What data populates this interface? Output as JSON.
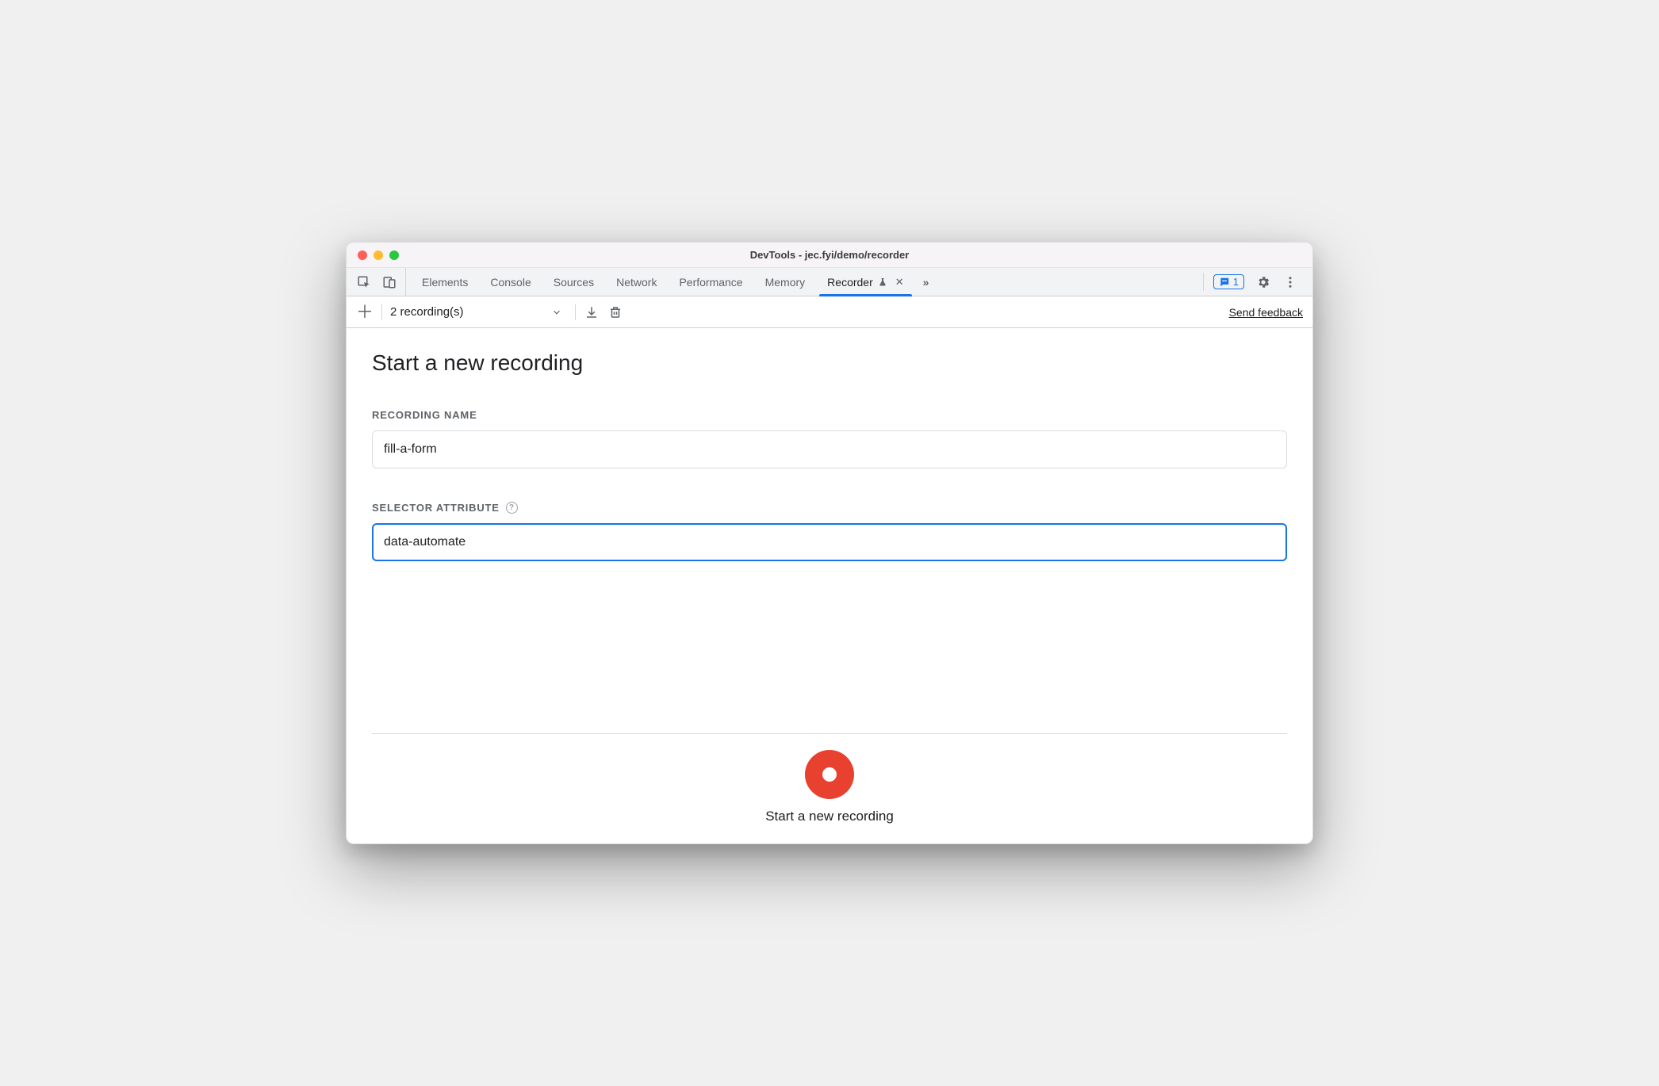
{
  "window": {
    "title": "DevTools - jec.fyi/demo/recorder"
  },
  "tabs": {
    "items": [
      {
        "label": "Elements"
      },
      {
        "label": "Console"
      },
      {
        "label": "Sources"
      },
      {
        "label": "Network"
      },
      {
        "label": "Performance"
      },
      {
        "label": "Memory"
      },
      {
        "label": "Recorder",
        "active": true,
        "flask": true,
        "closeable": true
      }
    ]
  },
  "badge": {
    "count": "1"
  },
  "subbar": {
    "recordings_label": "2 recording(s)",
    "feedback_label": "Send feedback"
  },
  "main": {
    "page_title": "Start a new recording",
    "recording_name_label": "Recording Name",
    "recording_name_value": "fill-a-form",
    "selector_attribute_label": "Selector Attribute",
    "selector_attribute_value": "data-automate"
  },
  "footer": {
    "record_label": "Start a new recording"
  }
}
